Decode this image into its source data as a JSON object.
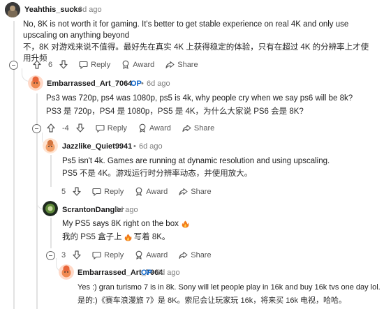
{
  "comments": [
    {
      "author": "Yeahthis_sucks",
      "time": "6d ago",
      "text_en": "No, 8K is not worth it for gaming. It's better to get stable experience on real 4K and only use upscaling on anything beyond",
      "text_zh": "不，8K 对游戏来说不值得。最好先在真实 4K 上获得稳定的体验，只有在超过 4K 的分辨率上才使用升频",
      "votes": "6"
    },
    {
      "author": "Embarrassed_Art_7064",
      "op_badge": "OP",
      "time": "6d ago",
      "text_en": "Ps3 was 720p, ps4 was 1080p, ps5 is 4k, why people cry when we say ps6 will be 8k?",
      "text_zh": "PS3 是 720p，PS4 是 1080p，PS5 是 4K，为什么大家说 PS6 会是 8K?",
      "votes": "-4"
    },
    {
      "author": "Jazzlike_Quiet9941",
      "time": "6d ago",
      "text_en": "Ps5 isn't 4k. Games are running at dynamic resolution and using upscaling.",
      "text_zh": "PS5 不是 4K。游戏运行时分辨率动态，并使用放大。",
      "votes": "5"
    },
    {
      "author": "ScrantonDangler",
      "time": "6d ago",
      "text_en": "My PS5 says 8K right on the box",
      "text_zh_a": "我的 PS5 盒子上",
      "text_zh_b": "写着 8K。",
      "votes": "3"
    },
    {
      "author": "Embarrassed_Art_7064",
      "op_badge": "OP",
      "time": "6d ago",
      "text_en": "Yes :) gran turismo 7 is in 8k. Sony will let people play in 16k and buy 16k tvs one day lol.",
      "text_zh": "是的:)《赛车浪漫旅 7》是 8K。索尼会让玩家玩 16k，将来买 16k 电视，哈哈。"
    }
  ],
  "actions": {
    "reply": "Reply",
    "award": "Award",
    "share": "Share",
    "separator": "•"
  },
  "colors": {
    "op": "#0a63c9",
    "thread_line": "#e2e2e2",
    "meta": "#7c7c7c"
  }
}
